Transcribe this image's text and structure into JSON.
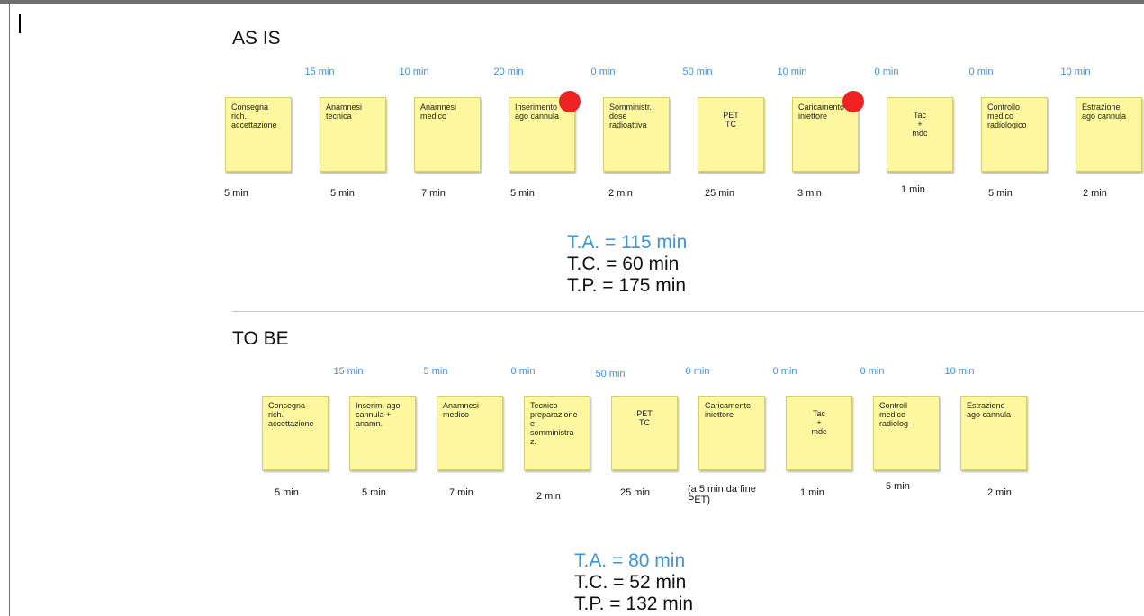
{
  "colors": {
    "wait_time": "#3a94e0",
    "note": "#fdf79f",
    "bottleneck_dot": "#ee2222"
  },
  "as_is": {
    "title": "AS IS",
    "waits": [
      "15 min",
      "10 min",
      "20 min",
      "0 min",
      "50 min",
      "10 min",
      "0 min",
      "0 min",
      "10 min"
    ],
    "steps": [
      {
        "label": "Consegna\nrich.\naccettazione",
        "time": "5 min"
      },
      {
        "label": "Anamnesi\ntecnica",
        "time": "5 min"
      },
      {
        "label": "Anamnesi\nmedico",
        "time": "7 min"
      },
      {
        "label": "Inserimento\nago cannula",
        "time": "5 min",
        "bottleneck": true
      },
      {
        "label": "Somministr.\ndose\nradioattiva",
        "time": "2 min"
      },
      {
        "label": "PET\nTC",
        "time": "25 min"
      },
      {
        "label": "Caricamento\niniettore",
        "time": "3 min",
        "bottleneck": true
      },
      {
        "label": "Tac\n+\nmdc",
        "time": "1 min"
      },
      {
        "label": "Controllo\nmedico\nradiologico",
        "time": "5 min"
      },
      {
        "label": "Estrazione\nago cannula",
        "time": "2 min"
      }
    ],
    "totals": {
      "ta": "T.A. = 115 min",
      "tc": "T.C. = 60 min",
      "tp": "T.P. = 175 min"
    }
  },
  "to_be": {
    "title": "TO BE",
    "waits": [
      "15 min",
      "5 min",
      "0 min",
      "50 min",
      "0 min",
      "0 min",
      "0 min",
      "10 min"
    ],
    "steps": [
      {
        "label": "Consegna\nrich.\naccettazione",
        "time": "5 min"
      },
      {
        "label": "Inserim. ago\ncannula +\nanamn.",
        "time": "5 min"
      },
      {
        "label": "Anamnesi\nmedico",
        "time": "7 min"
      },
      {
        "label": "Tecnico\npreparazione\ne\nsomministra\nz.",
        "time": "2 min"
      },
      {
        "label": "PET\nTC",
        "time": "25 min"
      },
      {
        "label": "Caricamento\niniettore",
        "time": "(a 5 min da fine\nPET)"
      },
      {
        "label": "Tac\n+\nmdc",
        "time": "1 min"
      },
      {
        "label": "Controll\nmedico\nradiolog",
        "time": "5 min"
      },
      {
        "label": "Estrazione\nago cannula",
        "time": "2 min"
      }
    ],
    "totals": {
      "ta": "T.A. = 80 min",
      "tc": "T.C. = 52 min",
      "tp": "T.P. = 132 min"
    }
  }
}
